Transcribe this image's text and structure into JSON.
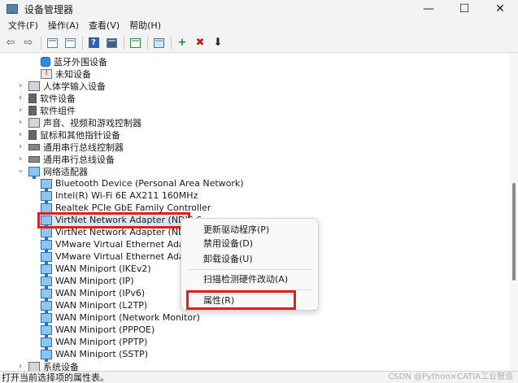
{
  "window": {
    "title": "设备管理器",
    "minimize": "—",
    "maximize": "☐",
    "close": "✕"
  },
  "menubar": [
    "文件(F)",
    "操作(A)",
    "查看(V)",
    "帮助(H)"
  ],
  "toolbar": {
    "back": "⇦",
    "forward": "⇨",
    "help": "?",
    "add": "+",
    "remove": "✖",
    "update": "⬇"
  },
  "tree_rows": [
    {
      "label": "蓝牙外围设备",
      "icon": "bluetooth-device-icon"
    },
    {
      "label": "未知设备",
      "icon": "unknown-device-icon"
    },
    {
      "label": "人体学输入设备",
      "icon": "hid-icon"
    },
    {
      "label": "软件设备",
      "icon": "software-device-icon"
    },
    {
      "label": "软件组件",
      "icon": "software-component-icon"
    },
    {
      "label": "声音、视频和游戏控制器",
      "icon": "audio-icon"
    },
    {
      "label": "鼠标和其他指针设备",
      "icon": "mouse-icon"
    },
    {
      "label": "通用串行总线控制器",
      "icon": "usb-icon"
    },
    {
      "label": "通用串行总线设备",
      "icon": "usb-icon"
    },
    {
      "label": "网络适配器",
      "icon": "network-icon"
    },
    {
      "label": "Bluetooth Device (Personal Area Network)",
      "icon": "network-adapter-icon"
    },
    {
      "label": "Intel(R) Wi-Fi 6E AX211 160MHz",
      "icon": "network-adapter-icon"
    },
    {
      "label": "Realtek PCIe GbE Family Controller",
      "icon": "network-adapter-icon"
    },
    {
      "label": "VirtNet Network Adapter (NDIS 6",
      "icon": "network-adapter-icon"
    },
    {
      "label": "VirtNet Network Adapter (NDIS 6",
      "icon": "network-adapter-icon"
    },
    {
      "label": "VMware Virtual Ethernet Adapter",
      "icon": "network-adapter-icon"
    },
    {
      "label": "VMware Virtual Ethernet Adapter",
      "icon": "network-adapter-icon"
    },
    {
      "label": "WAN Miniport (IKEv2)",
      "icon": "network-adapter-icon"
    },
    {
      "label": "WAN Miniport (IP)",
      "icon": "network-adapter-icon"
    },
    {
      "label": "WAN Miniport (IPv6)",
      "icon": "network-adapter-icon"
    },
    {
      "label": "WAN Miniport (L2TP)",
      "icon": "network-adapter-icon"
    },
    {
      "label": "WAN Miniport (Network Monitor)",
      "icon": "network-adapter-icon"
    },
    {
      "label": "WAN Miniport (PPPOE)",
      "icon": "network-adapter-icon"
    },
    {
      "label": "WAN Miniport (PPTP)",
      "icon": "network-adapter-icon"
    },
    {
      "label": "WAN Miniport (SSTP)",
      "icon": "network-adapter-icon"
    },
    {
      "label": "系统设备",
      "icon": "system-device-icon"
    }
  ],
  "context_menu": {
    "update_driver": "更新驱动程序(P)",
    "disable_device": "禁用设备(D)",
    "uninstall_device": "卸载设备(U)",
    "scan_hardware": "扫描检测硬件改动(A)",
    "properties": "属性(R)"
  },
  "status": "打开当前选择项的属性表。",
  "watermark": "CSDN @Python×CATIA工业智造",
  "colors": {
    "highlight": "#e0201c",
    "selection": "#dbe9f7",
    "accent": "#2f6fb3"
  }
}
